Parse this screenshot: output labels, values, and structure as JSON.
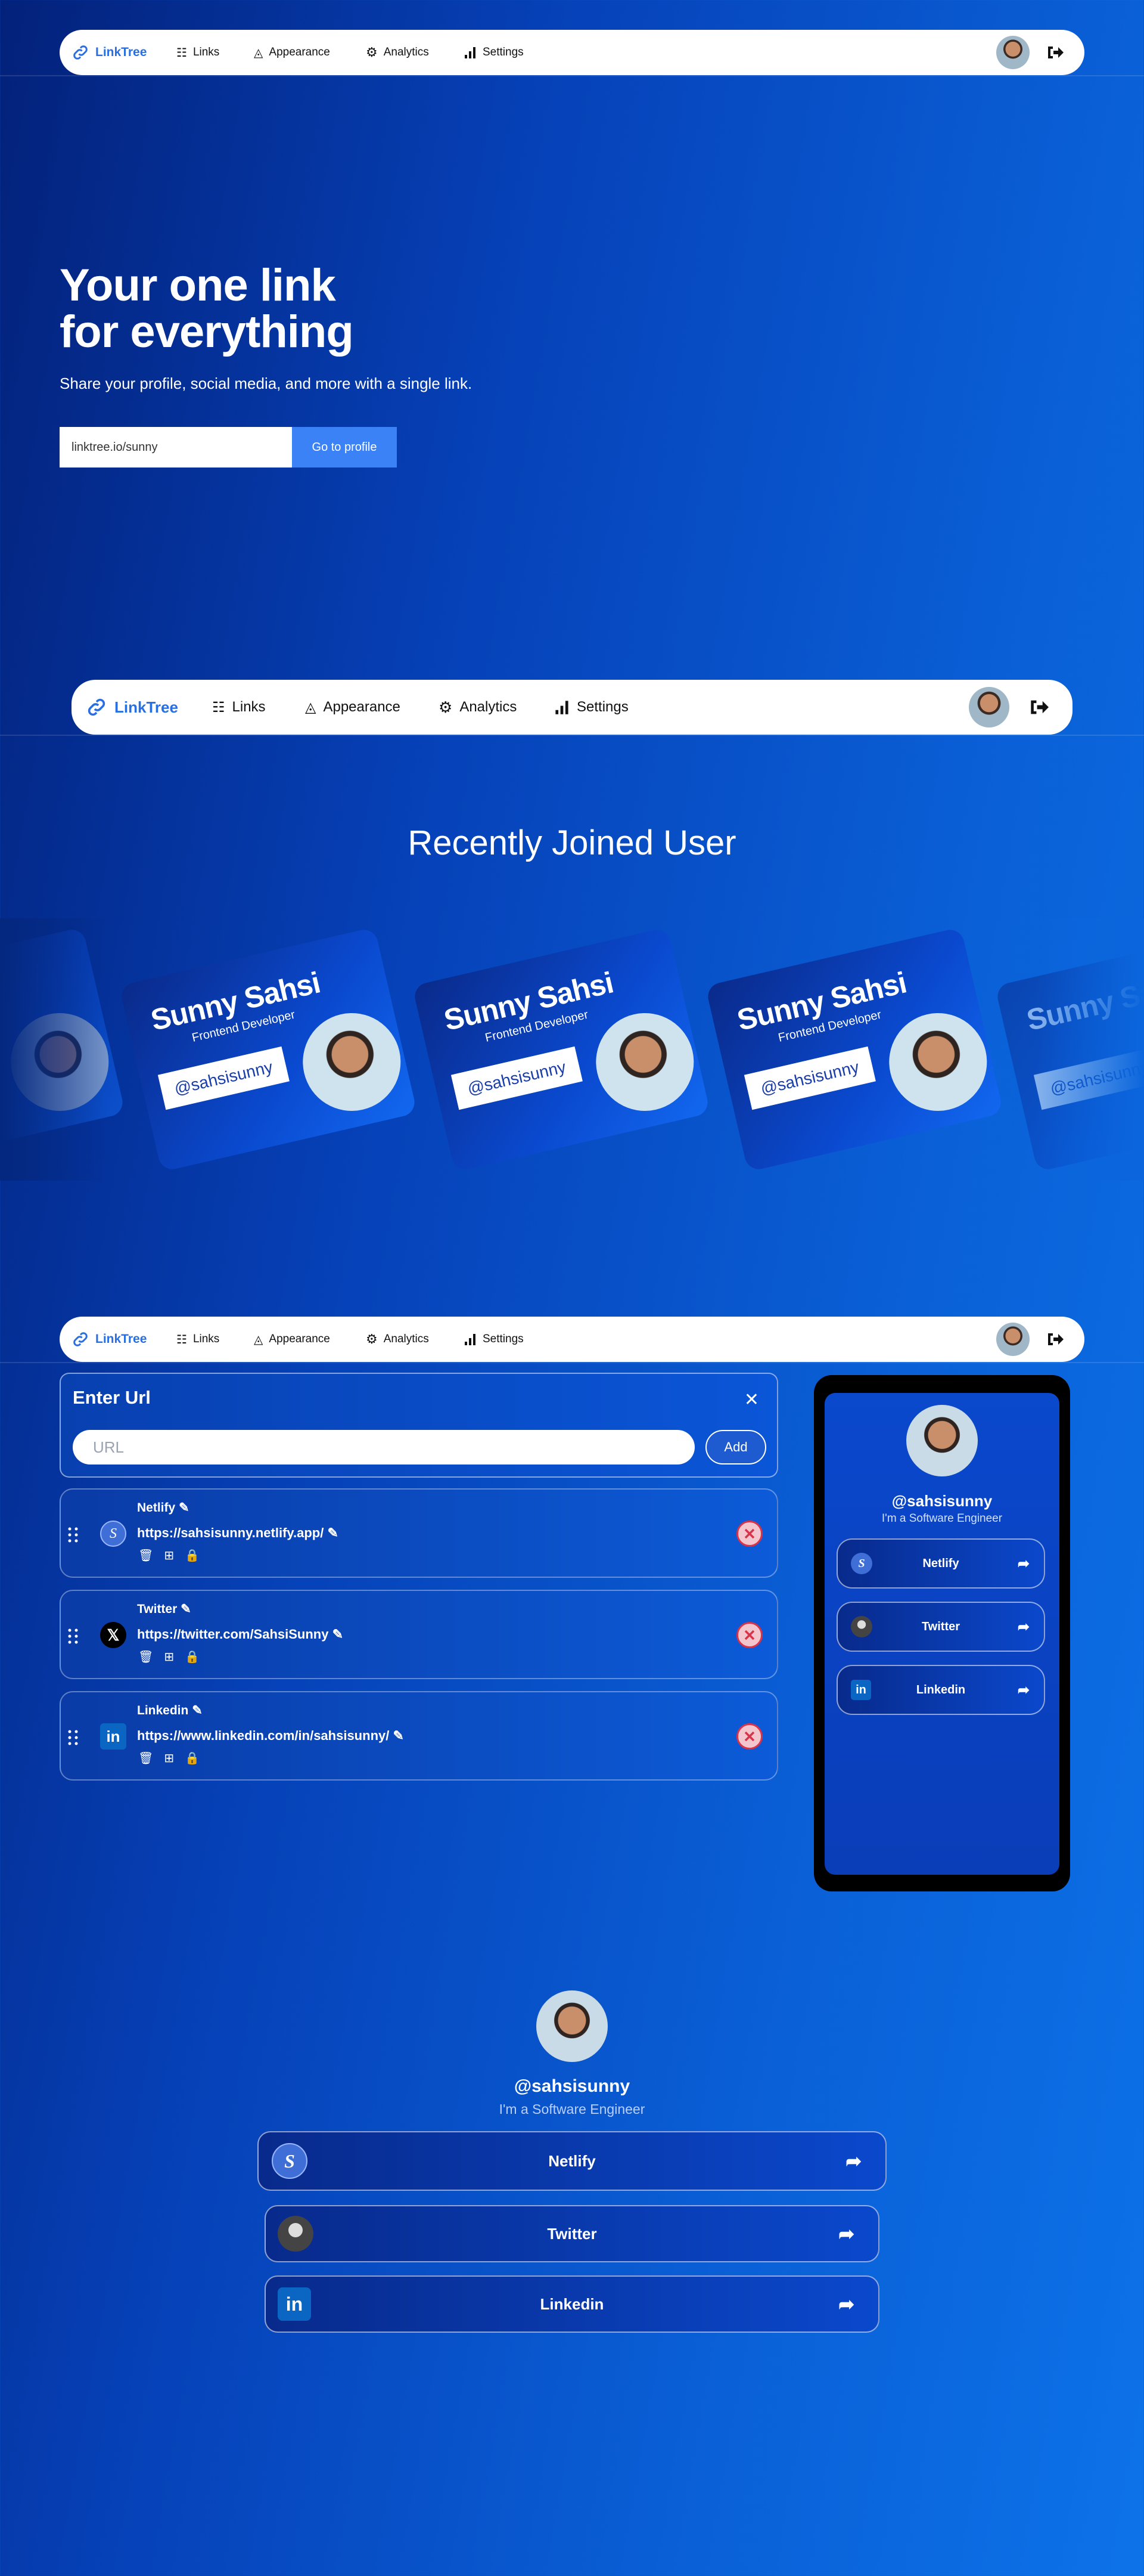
{
  "nav": {
    "brand": "LinkTree",
    "items": [
      {
        "label": "Links",
        "icon": "list-icon"
      },
      {
        "label": "Appearance",
        "icon": "shapes-icon"
      },
      {
        "label": "Analytics",
        "icon": "gear-icon"
      },
      {
        "label": "Settings",
        "icon": "bar-chart-icon"
      }
    ]
  },
  "hero": {
    "title_line1": "Your one link",
    "title_line2": "for everything",
    "subtitle": "Share your profile, social media, and more with a single link.",
    "input_value": "linktree.io/sunny",
    "button": "Go to profile"
  },
  "recent": {
    "title": "Recently Joined User",
    "card": {
      "name": "Sunny Sahsi",
      "role": "Frontend Developer",
      "handle": "@sahsisunny"
    }
  },
  "editor": {
    "title": "Enter Url",
    "placeholder": "URL",
    "add": "Add",
    "links": [
      {
        "name": "Netlify",
        "url": "https://sahsisunny.netlify.app/"
      },
      {
        "name": "Twitter",
        "url": "https://twitter.com/SahsiSunny"
      },
      {
        "name": "Linkedin",
        "url": "https://www.linkedin.com/in/sahsisunny/"
      }
    ]
  },
  "profile": {
    "handle": "@sahsisunny",
    "bio": "I'm a Software Engineer",
    "links": [
      "Netlify",
      "Twitter",
      "Linkedin"
    ]
  },
  "colors": {
    "accent": "#2a6fe0",
    "button": "#3b82f6",
    "delete": "#d9334a"
  }
}
